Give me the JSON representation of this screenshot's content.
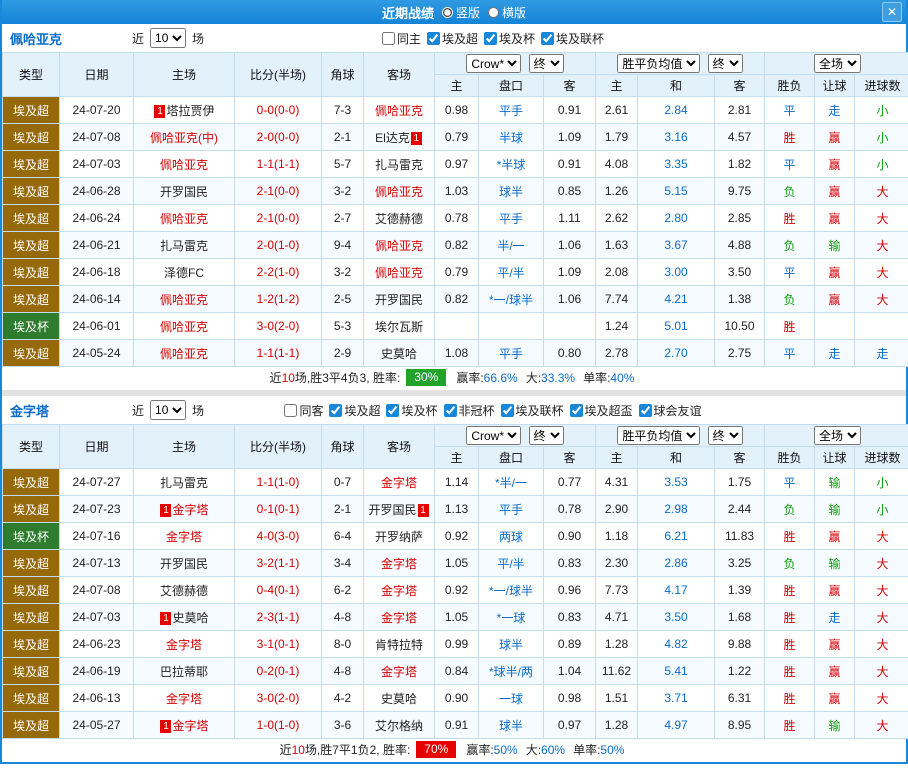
{
  "titlebar": {
    "title": "近期战绩",
    "radio_vertical": "竖版",
    "radio_horizontal": "横版",
    "close_icon": "✕"
  },
  "columns": {
    "type": "类型",
    "date": "日期",
    "home": "主场",
    "score": "比分(半场)",
    "corner": "角球",
    "away": "客场",
    "odds_home": "主",
    "handicap": "盘口",
    "odds_away": "客",
    "avg_home": "主",
    "avg_draw": "和",
    "avg_away": "客",
    "result": "胜负",
    "handicap_result": "让球",
    "goals": "进球数"
  },
  "selects": {
    "company": "Crow*",
    "final": "终",
    "avg_label": "胜平负均值",
    "period": "全场"
  },
  "colors": {
    "titlebar_blue": "#1a88d8",
    "red": "#d60000",
    "blue": "#0a6cc8",
    "green": "#0f9d0f",
    "league_super_bg": "#96690a",
    "league_cup_bg": "#2e7d2e"
  },
  "sections": [
    {
      "team": "佩哈亚克",
      "filter": {
        "near": "近",
        "count": "10",
        "unit": "场",
        "checkboxes": [
          {
            "label": "同主",
            "checked": false
          },
          {
            "label": "埃及超",
            "checked": true
          },
          {
            "label": "埃及杯",
            "checked": true
          },
          {
            "label": "埃及联杯",
            "checked": true
          }
        ]
      },
      "rows": [
        {
          "league": "埃及超",
          "league_type": "super",
          "date": "24-07-20",
          "home": "塔拉贾伊",
          "home_red": false,
          "home_badge": "1",
          "home_badge_side": "left",
          "score": "0-0(0-0)",
          "corner": "7-3",
          "away": "佩哈亚克",
          "away_red": true,
          "o1": "0.98",
          "hcp": "平手",
          "o2": "0.91",
          "a1": "2.61",
          "a2": "2.84",
          "a3": "2.81",
          "res": "平",
          "res_c": "blue",
          "let": "走",
          "let_c": "blue",
          "goal": "小",
          "goal_c": "green"
        },
        {
          "league": "埃及超",
          "league_type": "super",
          "date": "24-07-08",
          "home": "佩哈亚克(中)",
          "home_red": true,
          "score": "2-0(0-0)",
          "corner": "2-1",
          "away": "El达克",
          "away_red": false,
          "away_badge": "1",
          "away_badge_side": "right",
          "o1": "0.79",
          "hcp": "半球",
          "o2": "1.09",
          "a1": "1.79",
          "a2": "3.16",
          "a3": "4.57",
          "res": "胜",
          "res_c": "red",
          "let": "赢",
          "let_c": "red",
          "goal": "小",
          "goal_c": "green"
        },
        {
          "league": "埃及超",
          "league_type": "super",
          "date": "24-07-03",
          "home": "佩哈亚克",
          "home_red": true,
          "score": "1-1(1-1)",
          "corner": "5-7",
          "away": "扎马雷克",
          "away_red": false,
          "o1": "0.97",
          "hcp": "*半球",
          "o2": "0.91",
          "a1": "4.08",
          "a2": "3.35",
          "a3": "1.82",
          "res": "平",
          "res_c": "blue",
          "let": "赢",
          "let_c": "red",
          "goal": "小",
          "goal_c": "green"
        },
        {
          "league": "埃及超",
          "league_type": "super",
          "date": "24-06-28",
          "home": "开罗国民",
          "home_red": false,
          "score": "2-1(0-0)",
          "corner": "3-2",
          "away": "佩哈亚克",
          "away_red": true,
          "o1": "1.03",
          "hcp": "球半",
          "o2": "0.85",
          "a1": "1.26",
          "a2": "5.15",
          "a3": "9.75",
          "res": "负",
          "res_c": "green",
          "let": "赢",
          "let_c": "red",
          "goal": "大",
          "goal_c": "red"
        },
        {
          "league": "埃及超",
          "league_type": "super",
          "date": "24-06-24",
          "home": "佩哈亚克",
          "home_red": true,
          "score": "2-1(0-0)",
          "corner": "2-7",
          "away": "艾德赫德",
          "away_red": false,
          "o1": "0.78",
          "hcp": "平手",
          "o2": "1.11",
          "a1": "2.62",
          "a2": "2.80",
          "a3": "2.85",
          "res": "胜",
          "res_c": "red",
          "let": "赢",
          "let_c": "red",
          "goal": "大",
          "goal_c": "red"
        },
        {
          "league": "埃及超",
          "league_type": "super",
          "date": "24-06-21",
          "home": "扎马雷克",
          "home_red": false,
          "score": "2-0(1-0)",
          "corner": "9-4",
          "away": "佩哈亚克",
          "away_red": true,
          "o1": "0.82",
          "hcp": "半/一",
          "o2": "1.06",
          "a1": "1.63",
          "a2": "3.67",
          "a3": "4.88",
          "res": "负",
          "res_c": "green",
          "let": "输",
          "let_c": "green",
          "goal": "大",
          "goal_c": "red"
        },
        {
          "league": "埃及超",
          "league_type": "super",
          "date": "24-06-18",
          "home": "泽德FC",
          "home_red": false,
          "score": "2-2(1-0)",
          "corner": "3-2",
          "away": "佩哈亚克",
          "away_red": true,
          "o1": "0.79",
          "hcp": "平/半",
          "o2": "1.09",
          "a1": "2.08",
          "a2": "3.00",
          "a3": "3.50",
          "res": "平",
          "res_c": "blue",
          "let": "赢",
          "let_c": "red",
          "goal": "大",
          "goal_c": "red"
        },
        {
          "league": "埃及超",
          "league_type": "super",
          "date": "24-06-14",
          "home": "佩哈亚克",
          "home_red": true,
          "score": "1-2(1-2)",
          "corner": "2-5",
          "away": "开罗国民",
          "away_red": false,
          "o1": "0.82",
          "hcp": "*一/球半",
          "o2": "1.06",
          "a1": "7.74",
          "a2": "4.21",
          "a3": "1.38",
          "res": "负",
          "res_c": "green",
          "let": "赢",
          "let_c": "red",
          "goal": "大",
          "goal_c": "red"
        },
        {
          "league": "埃及杯",
          "league_type": "cup",
          "date": "24-06-01",
          "home": "佩哈亚克",
          "home_red": true,
          "score": "3-0(2-0)",
          "corner": "5-3",
          "away": "埃尔瓦斯",
          "away_red": false,
          "o1": "",
          "hcp": "",
          "o2": "",
          "a1": "1.24",
          "a2": "5.01",
          "a3": "10.50",
          "res": "胜",
          "res_c": "red",
          "let": "",
          "let_c": "blue",
          "goal": "",
          "goal_c": "blue"
        },
        {
          "league": "埃及超",
          "league_type": "super",
          "date": "24-05-24",
          "home": "佩哈亚克",
          "home_red": true,
          "score": "1-1(1-1)",
          "corner": "2-9",
          "away": "史莫哈",
          "away_red": false,
          "o1": "1.08",
          "hcp": "平手",
          "o2": "0.80",
          "a1": "2.78",
          "a2": "2.70",
          "a3": "2.75",
          "res": "平",
          "res_c": "blue",
          "let": "走",
          "let_c": "blue",
          "goal": "走",
          "goal_c": "blue"
        }
      ],
      "footer": {
        "prefix": "近",
        "count": "10",
        "record": "场,胜3平4负3, 胜率:",
        "rate": "30%",
        "rate_color": "#21a32c",
        "stats": [
          {
            "label": "赢率:",
            "value": "66.6%"
          },
          {
            "label": "大:",
            "value": "33.3%"
          },
          {
            "label": "单率:",
            "value": "40%"
          }
        ]
      }
    },
    {
      "team": "金字塔",
      "filter": {
        "near": "近",
        "count": "10",
        "unit": "场",
        "checkboxes": [
          {
            "label": "同客",
            "checked": false
          },
          {
            "label": "埃及超",
            "checked": true
          },
          {
            "label": "埃及杯",
            "checked": true
          },
          {
            "label": "非冠杯",
            "checked": true
          },
          {
            "label": "埃及联杯",
            "checked": true
          },
          {
            "label": "埃及超盃",
            "checked": true
          },
          {
            "label": "球会友谊",
            "checked": true
          }
        ]
      },
      "rows": [
        {
          "league": "埃及超",
          "league_type": "super",
          "date": "24-07-27",
          "home": "扎马雷克",
          "home_red": false,
          "score": "1-1(1-0)",
          "corner": "0-7",
          "away": "金字塔",
          "away_red": true,
          "o1": "1.14",
          "hcp": "*半/一",
          "o2": "0.77",
          "a1": "4.31",
          "a2": "3.53",
          "a3": "1.75",
          "res": "平",
          "res_c": "blue",
          "let": "输",
          "let_c": "green",
          "goal": "小",
          "goal_c": "green"
        },
        {
          "league": "埃及超",
          "league_type": "super",
          "date": "24-07-23",
          "home": "金字塔",
          "home_red": true,
          "home_badge": "1",
          "home_badge_side": "left",
          "score": "0-1(0-1)",
          "corner": "2-1",
          "away": "开罗国民",
          "away_red": false,
          "away_badge": "1",
          "away_badge_side": "right",
          "o1": "1.13",
          "hcp": "平手",
          "o2": "0.78",
          "a1": "2.90",
          "a2": "2.98",
          "a3": "2.44",
          "res": "负",
          "res_c": "green",
          "let": "输",
          "let_c": "green",
          "goal": "小",
          "goal_c": "green"
        },
        {
          "league": "埃及杯",
          "league_type": "cup",
          "date": "24-07-16",
          "home": "金字塔",
          "home_red": true,
          "score": "4-0(3-0)",
          "corner": "6-4",
          "away": "开罗纳萨",
          "away_red": false,
          "o1": "0.92",
          "hcp": "两球",
          "o2": "0.90",
          "a1": "1.18",
          "a2": "6.21",
          "a3": "11.83",
          "res": "胜",
          "res_c": "red",
          "let": "赢",
          "let_c": "red",
          "goal": "大",
          "goal_c": "red"
        },
        {
          "league": "埃及超",
          "league_type": "super",
          "date": "24-07-13",
          "home": "开罗国民",
          "home_red": false,
          "score": "3-2(1-1)",
          "corner": "3-4",
          "away": "金字塔",
          "away_red": true,
          "o1": "1.05",
          "hcp": "平/半",
          "o2": "0.83",
          "a1": "2.30",
          "a2": "2.86",
          "a3": "3.25",
          "res": "负",
          "res_c": "green",
          "let": "输",
          "let_c": "green",
          "goal": "大",
          "goal_c": "red"
        },
        {
          "league": "埃及超",
          "league_type": "super",
          "date": "24-07-08",
          "home": "艾德赫德",
          "home_red": false,
          "score": "0-4(0-1)",
          "corner": "6-2",
          "away": "金字塔",
          "away_red": true,
          "o1": "0.92",
          "hcp": "*一/球半",
          "o2": "0.96",
          "a1": "7.73",
          "a2": "4.17",
          "a3": "1.39",
          "res": "胜",
          "res_c": "red",
          "let": "赢",
          "let_c": "red",
          "goal": "大",
          "goal_c": "red"
        },
        {
          "league": "埃及超",
          "league_type": "super",
          "date": "24-07-03",
          "home": "史莫哈",
          "home_red": false,
          "home_badge": "1",
          "home_badge_side": "left",
          "score": "2-3(1-1)",
          "corner": "4-8",
          "away": "金字塔",
          "away_red": true,
          "o1": "1.05",
          "hcp": "*一球",
          "o2": "0.83",
          "a1": "4.71",
          "a2": "3.50",
          "a3": "1.68",
          "res": "胜",
          "res_c": "red",
          "let": "走",
          "let_c": "blue",
          "goal": "大",
          "goal_c": "red"
        },
        {
          "league": "埃及超",
          "league_type": "super",
          "date": "24-06-23",
          "home": "金字塔",
          "home_red": true,
          "score": "3-1(0-1)",
          "corner": "8-0",
          "away": "肯特拉特",
          "away_red": false,
          "o1": "0.99",
          "hcp": "球半",
          "o2": "0.89",
          "a1": "1.28",
          "a2": "4.82",
          "a3": "9.88",
          "res": "胜",
          "res_c": "red",
          "let": "赢",
          "let_c": "red",
          "goal": "大",
          "goal_c": "red"
        },
        {
          "league": "埃及超",
          "league_type": "super",
          "date": "24-06-19",
          "home": "巴拉蒂耶",
          "home_red": false,
          "score": "0-2(0-1)",
          "corner": "4-8",
          "away": "金字塔",
          "away_red": true,
          "o1": "0.84",
          "hcp": "*球半/两",
          "o2": "1.04",
          "a1": "11.62",
          "a2": "5.41",
          "a3": "1.22",
          "res": "胜",
          "res_c": "red",
          "let": "赢",
          "let_c": "red",
          "goal": "大",
          "goal_c": "red"
        },
        {
          "league": "埃及超",
          "league_type": "super",
          "date": "24-06-13",
          "home": "金字塔",
          "home_red": true,
          "score": "3-0(2-0)",
          "corner": "4-2",
          "away": "史莫哈",
          "away_red": false,
          "o1": "0.90",
          "hcp": "一球",
          "o2": "0.98",
          "a1": "1.51",
          "a2": "3.71",
          "a3": "6.31",
          "res": "胜",
          "res_c": "red",
          "let": "赢",
          "let_c": "red",
          "goal": "大",
          "goal_c": "red"
        },
        {
          "league": "埃及超",
          "league_type": "super",
          "date": "24-05-27",
          "home": "金字塔",
          "home_red": true,
          "home_badge": "1",
          "home_badge_side": "left",
          "score": "1-0(1-0)",
          "corner": "3-6",
          "away": "艾尔格纳",
          "away_red": false,
          "o1": "0.91",
          "hcp": "球半",
          "o2": "0.97",
          "a1": "1.28",
          "a2": "4.97",
          "a3": "8.95",
          "res": "胜",
          "res_c": "red",
          "let": "输",
          "let_c": "green",
          "goal": "大",
          "goal_c": "red"
        }
      ],
      "footer": {
        "prefix": "近",
        "count": "10",
        "record": "场,胜7平1负2, 胜率:",
        "rate": "70%",
        "rate_color": "#e60000",
        "stats": [
          {
            "label": "赢率:",
            "value": "50%"
          },
          {
            "label": "大:",
            "value": "60%"
          },
          {
            "label": "单率:",
            "value": "50%"
          }
        ]
      }
    }
  ]
}
